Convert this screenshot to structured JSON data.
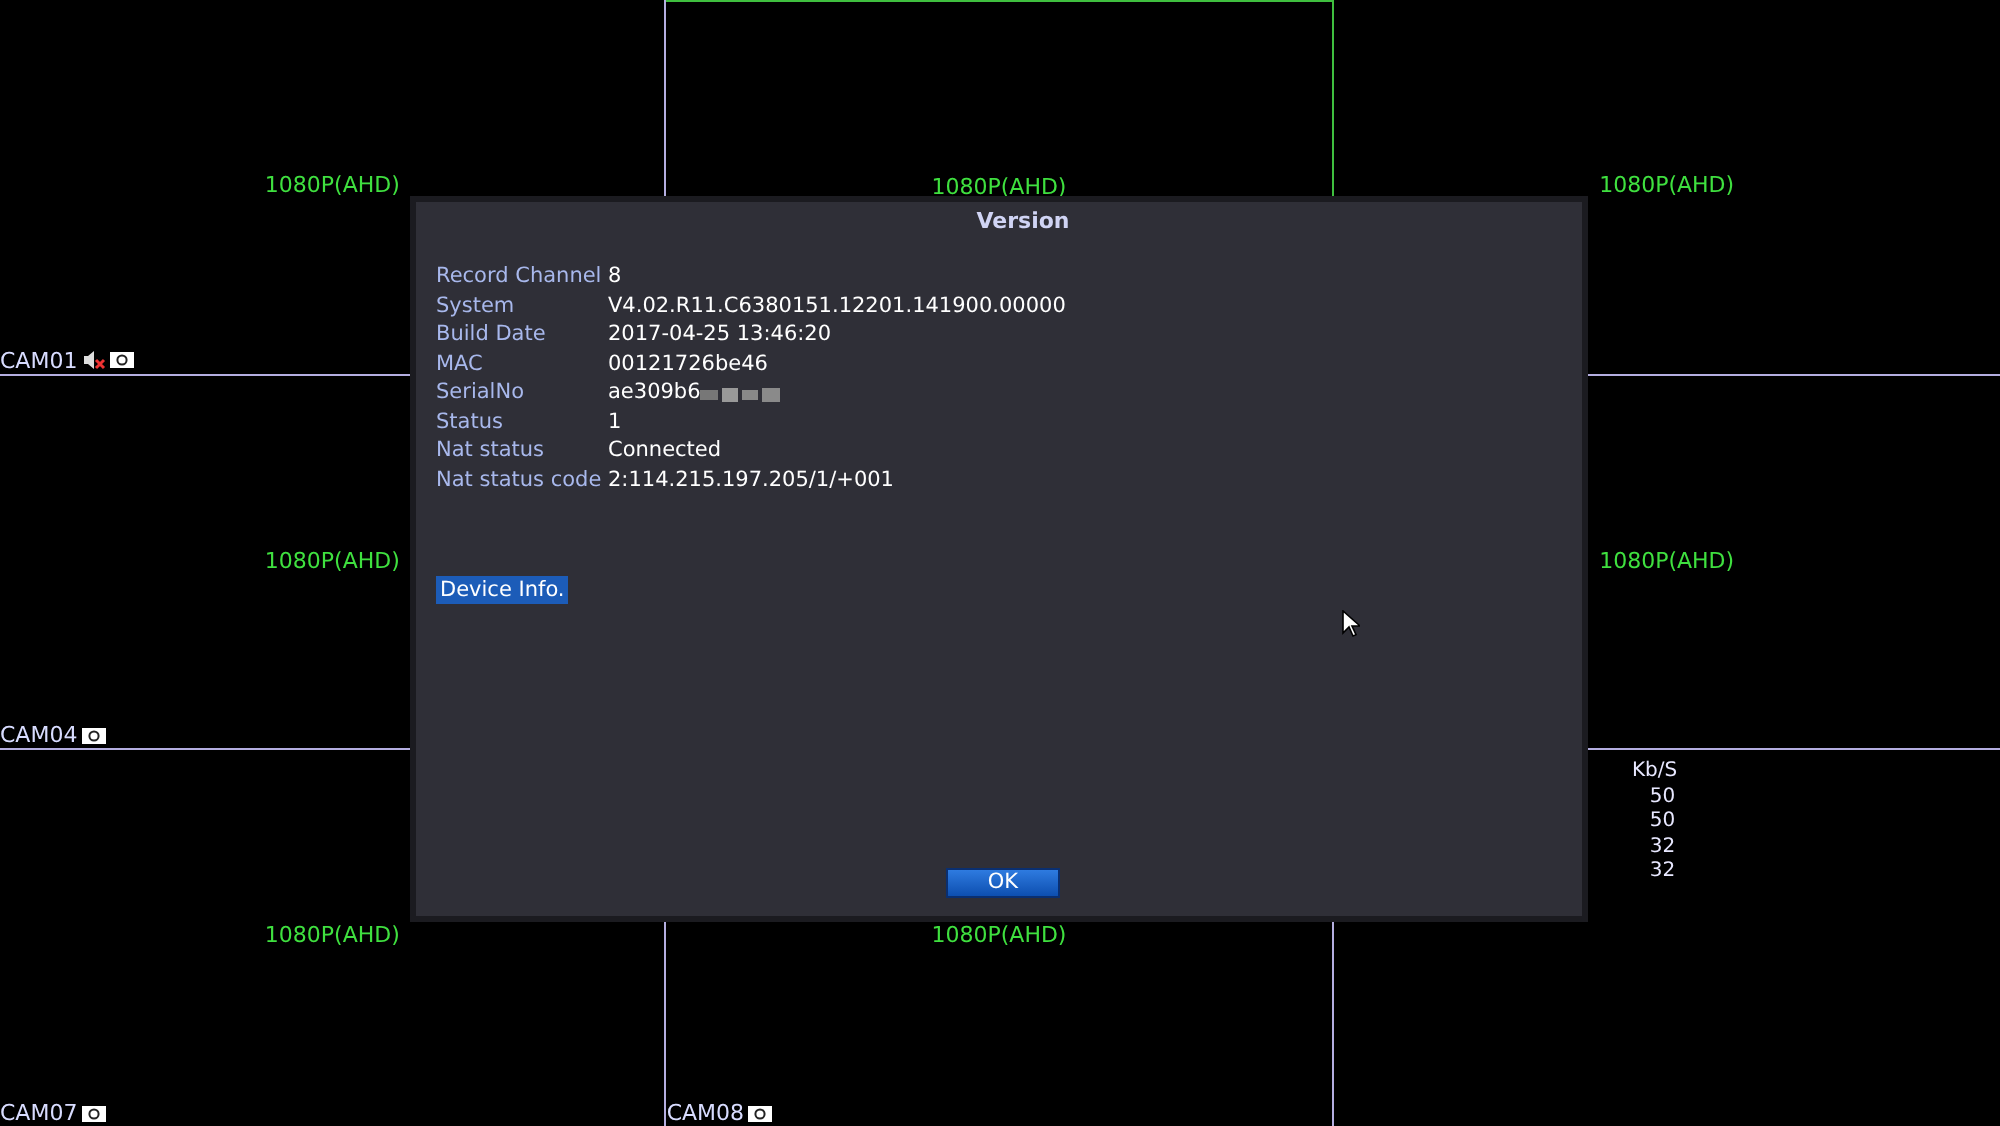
{
  "cells": [
    {
      "resolution": "1080P(AHD)",
      "label": "CAM01",
      "audio_muted": true,
      "selected": false
    },
    {
      "resolution": "1080P(AHD)",
      "selected": true
    },
    {
      "resolution": "1080P(AHD)",
      "selected": false
    },
    {
      "resolution": "1080P(AHD)",
      "label": "CAM04",
      "audio_muted": false,
      "selected": false
    },
    {},
    {
      "resolution": "1080P(AHD)",
      "selected": false
    },
    {
      "resolution": "1080P(AHD)",
      "label": "CAM07",
      "audio_muted": false,
      "selected": false
    },
    {
      "resolution": "1080P(AHD)",
      "label": "CAM08",
      "audio_muted": false,
      "selected": false
    },
    {}
  ],
  "bitrate": {
    "header": "Kb/S",
    "values": [
      "50",
      "50",
      "32",
      "32"
    ]
  },
  "dialog": {
    "title": "Version",
    "fields": [
      {
        "label": "Record Channel",
        "value": "8"
      },
      {
        "label": "System",
        "value": "V4.02.R11.C6380151.12201.141900.00000"
      },
      {
        "label": "Build Date",
        "value": "2017-04-25 13:46:20"
      },
      {
        "label": "MAC",
        "value": "00121726be46"
      },
      {
        "label": "SerialNo",
        "value": "ae309b6",
        "redacted": true
      },
      {
        "label": "Status",
        "value": "1"
      },
      {
        "label": "Nat status",
        "value": "Connected"
      },
      {
        "label": "Nat status code",
        "value": "2:114.215.197.205/1/+001"
      }
    ],
    "device_info_button": "Device Info.",
    "ok_button": "OK"
  }
}
